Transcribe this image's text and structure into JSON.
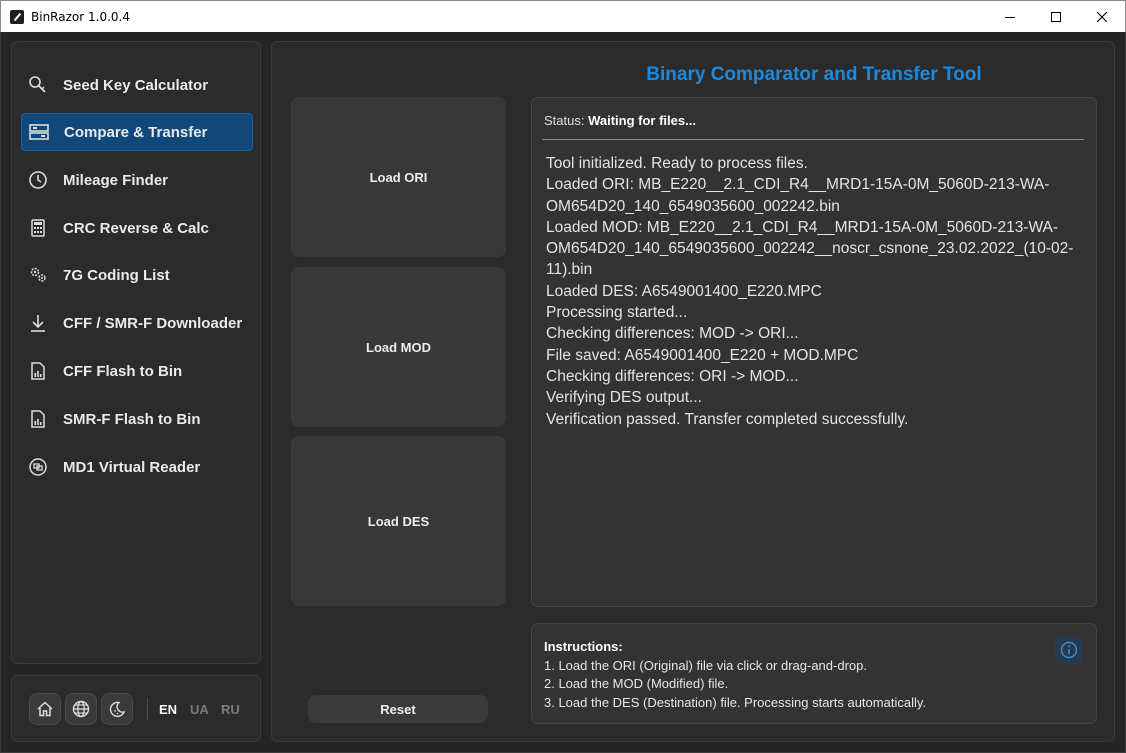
{
  "window": {
    "title": "BinRazor 1.0.0.4"
  },
  "sidebar": {
    "items": [
      {
        "label": "Seed Key Calculator",
        "icon": "key-search-icon"
      },
      {
        "label": "Compare & Transfer",
        "icon": "compare-icon",
        "active": true
      },
      {
        "label": "Mileage Finder",
        "icon": "clock-icon"
      },
      {
        "label": "CRC Reverse & Calc",
        "icon": "calculator-icon"
      },
      {
        "label": "7G Coding List",
        "icon": "gears-icon"
      },
      {
        "label": "CFF / SMR-F Downloader",
        "icon": "download-icon"
      },
      {
        "label": "CFF Flash to Bin",
        "icon": "file-chart-icon"
      },
      {
        "label": "SMR-F Flash to Bin",
        "icon": "file-chart-icon"
      },
      {
        "label": "MD1 Virtual Reader",
        "icon": "chip-reader-icon"
      }
    ]
  },
  "footer": {
    "buttons": [
      "home-icon",
      "globe-icon",
      "moon-icon"
    ],
    "languages": [
      {
        "code": "EN",
        "active": true
      },
      {
        "code": "UA",
        "active": false
      },
      {
        "code": "RU",
        "active": false
      }
    ]
  },
  "main": {
    "title": "Binary Comparator and Transfer Tool",
    "load_ori": "Load ORI",
    "load_mod": "Load MOD",
    "load_des": "Load DES",
    "reset": "Reset",
    "status_label": "Status:",
    "status_value": "Waiting for files...",
    "log": [
      "Tool initialized. Ready to process files.",
      "Loaded ORI: MB_E220__2.1_CDI_R4__MRD1-15A-0M_5060D-213-WA-OM654D20_140_6549035600_002242.bin",
      "Loaded MOD: MB_E220__2.1_CDI_R4__MRD1-15A-0M_5060D-213-WA-OM654D20_140_6549035600_002242__noscr_csnone_23.02.2022_(10-02-11).bin",
      "Loaded DES: A6549001400_E220.MPC",
      "Processing started...",
      "Checking differences: MOD -> ORI...",
      "File saved: A6549001400_E220 + MOD.MPC",
      "Checking differences: ORI -> MOD...",
      "Verifying DES output...",
      "Verification passed. Transfer completed successfully."
    ],
    "instructions": {
      "title": "Instructions:",
      "lines": [
        "1. Load the ORI (Original) file via click or drag-and-drop.",
        "2. Load the MOD (Modified) file.",
        "3. Load the DES (Destination) file. Processing starts automatically."
      ]
    }
  },
  "colors": {
    "accent": "#1a8ae0",
    "active_nav": "#10487a",
    "background": "#252525",
    "panel": "#2b2b2b"
  }
}
